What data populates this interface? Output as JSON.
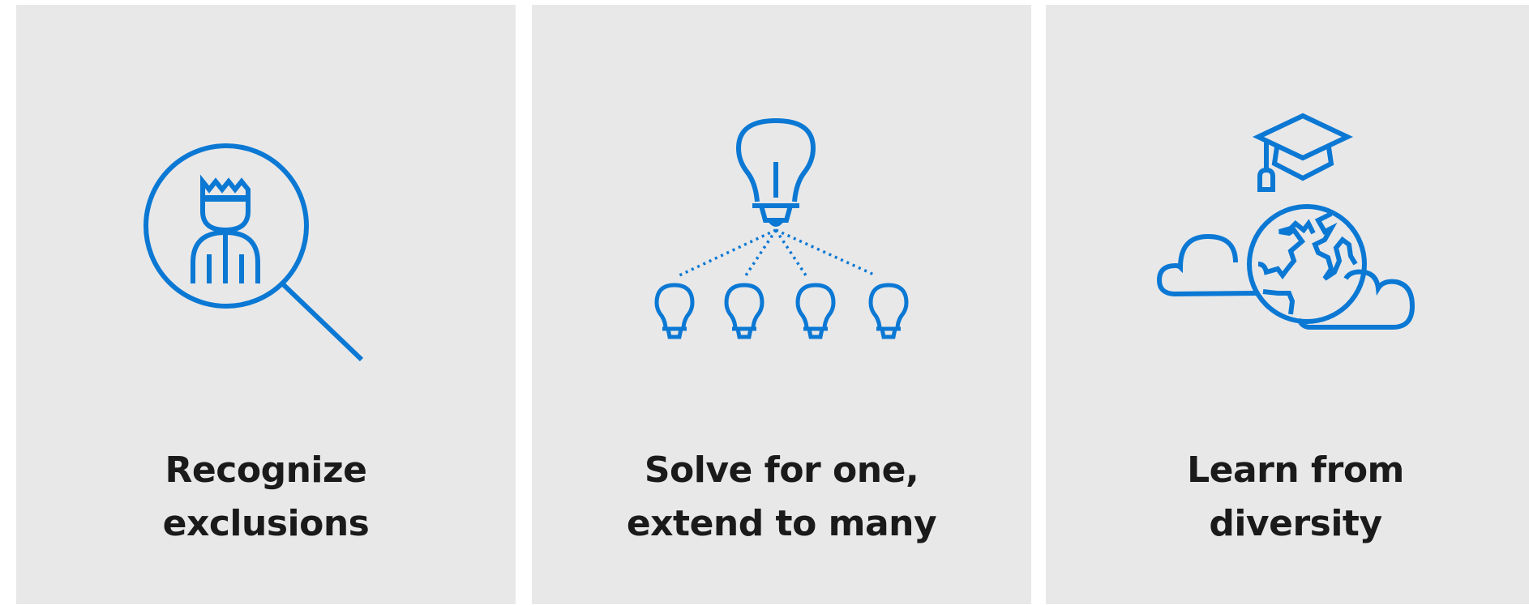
{
  "theme": {
    "accent": "#0b78d4",
    "card_bg": "#e8e8e8",
    "text": "#1a1a1a"
  },
  "cards": [
    {
      "icon": "magnifier-person-icon",
      "title_line1": "Recognize",
      "title_line2": "exclusions"
    },
    {
      "icon": "lightbulb-network-icon",
      "title_line1": "Solve for one,",
      "title_line2": "extend to many"
    },
    {
      "icon": "globe-graduation-icon",
      "title_line1": "Learn from",
      "title_line2": "diversity"
    }
  ]
}
